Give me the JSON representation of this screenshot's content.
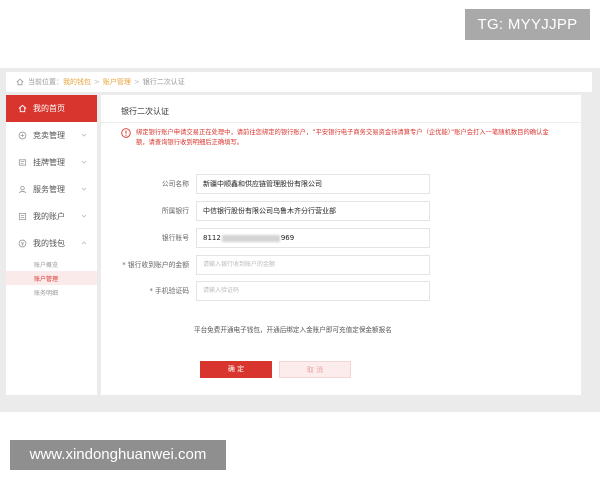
{
  "watermarks": {
    "top": "TG: MYYJJPP",
    "bottom": "www.xindonghuanwei.com"
  },
  "breadcrumb": {
    "prefix": "当前位置：",
    "items": [
      "我的钱包",
      "账户管理",
      "银行二次认证"
    ]
  },
  "sidebar": {
    "items": [
      {
        "label": "我的首页",
        "icon": "home-icon",
        "active": true
      },
      {
        "label": "竞卖管理",
        "icon": "auction-icon"
      },
      {
        "label": "挂牌管理",
        "icon": "listing-icon"
      },
      {
        "label": "服务管理",
        "icon": "service-icon"
      },
      {
        "label": "我的账户",
        "icon": "account-icon"
      },
      {
        "label": "我的钱包",
        "icon": "wallet-icon"
      }
    ],
    "wallet_sub": [
      "账户概览",
      "账户管理",
      "账务明细"
    ]
  },
  "card": {
    "title": "银行二次认证",
    "notice": "绑定银行账户申请交易正在处理中，请前往您绑定的银行账户，“平安银行电子商务交易资金待清算专户（企优能）”账户会打入一笔随机数目的确认金额，请查询银行收到明细后正确填写。"
  },
  "form": {
    "company_label": "公司名称",
    "company_value": "新疆中顺鑫和供应链管理股份有限公司",
    "bank_label": "所属银行",
    "bank_value": "中信银行股份有限公司乌鲁木齐分行营业部",
    "account_label": "银行账号",
    "account_prefix": "8112",
    "account_suffix": "969",
    "amount_label": "* 银行收到账户的金额",
    "amount_placeholder": "请输入银行收到账户的金额",
    "code_label": "* 手机验证码",
    "code_placeholder": "请输入验证码"
  },
  "promo": "平台免费开通电子钱包，开通后绑定入金账户即可充值定保金额报名",
  "buttons": {
    "confirm": "确 定",
    "cancel": "取 消"
  },
  "colors": {
    "accent": "#d7352e",
    "breadcrumb_link": "#e8a33c"
  }
}
